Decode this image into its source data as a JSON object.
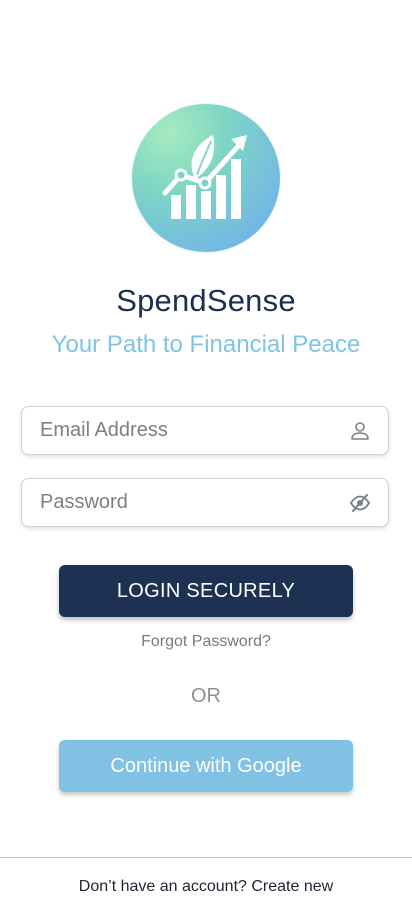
{
  "app": {
    "name": "SpendSense",
    "tagline": "Your Path to Financial Peace"
  },
  "logo": {
    "icon": "leaf-growth-chart-icon"
  },
  "form": {
    "email": {
      "placeholder": "Email Address",
      "value": "",
      "icon": "user-icon"
    },
    "password": {
      "placeholder": "Password",
      "value": "",
      "icon": "eye-off-icon"
    },
    "login_label": "LOGIN SECURELY",
    "forgot_label": "Forgot Password?",
    "or_label": "OR",
    "google_label": "Continue with Google"
  },
  "footer": {
    "prompt": "Don’t have an account?",
    "link": "Create new"
  },
  "colors": {
    "primary": "#1d3152",
    "accent": "#80c1e4",
    "title": "#1d2f4f",
    "tagline": "#80c3e3"
  }
}
